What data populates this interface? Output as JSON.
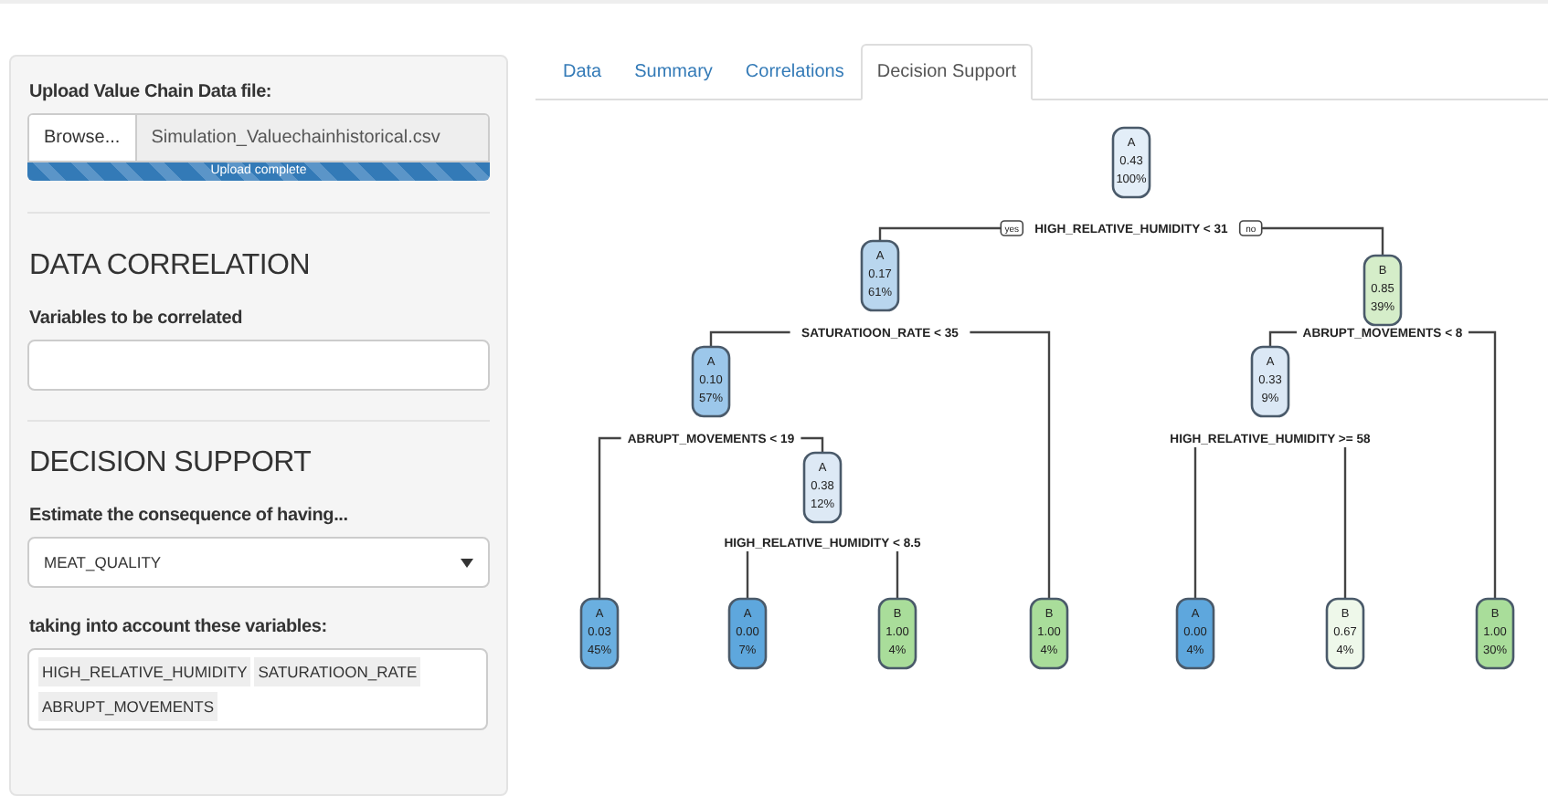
{
  "sidebar": {
    "upload": {
      "label": "Upload Value Chain Data file:",
      "button": "Browse...",
      "file_name": "Simulation_Valuechainhistorical.csv",
      "progress": {
        "level": 1,
        "text": "Upload complete"
      }
    },
    "correlation": {
      "heading": "DATA CORRELATION",
      "label": "Variables to be correlated"
    },
    "decision": {
      "heading": "DECISION SUPPORT",
      "target_label": "Estimate the consequence of having...",
      "target_value": "MEAT_QUALITY",
      "variables_label": "taking into account these variables:",
      "variables": [
        "HIGH_RELATIVE_HUMIDITY",
        "SATURATIOON_RATE",
        "ABRUPT_MOVEMENTS"
      ]
    }
  },
  "tabs": [
    {
      "label": "Data",
      "selected": false
    },
    {
      "label": "Summary",
      "selected": false
    },
    {
      "label": "Correlations",
      "selected": false
    },
    {
      "label": "Decision Support",
      "selected": true
    }
  ],
  "tree": {
    "cls": "A",
    "value": "0.43",
    "pct": "100%",
    "color": "#e3eef8",
    "split": "HIGH_RELATIVE_HUMIDITY < 31",
    "branch_labels": [
      "yes",
      "no"
    ],
    "children": [
      {
        "cls": "A",
        "value": "0.17",
        "pct": "61%",
        "color": "#b9d6ee",
        "split": "SATURATIOON_RATE < 35",
        "children": [
          {
            "cls": "A",
            "value": "0.10",
            "pct": "57%",
            "color": "#9cc7ea",
            "split": "ABRUPT_MOVEMENTS < 19",
            "children": [
              {
                "cls": "A",
                "value": "0.03",
                "pct": "45%",
                "color": "#6aafe0"
              },
              {
                "cls": "A",
                "value": "0.38",
                "pct": "12%",
                "color": "#dde9f5",
                "split": "HIGH_RELATIVE_HUMIDITY < 8.5",
                "children": [
                  {
                    "cls": "A",
                    "value": "0.00",
                    "pct": "7%",
                    "color": "#5ea7dd"
                  },
                  {
                    "cls": "B",
                    "value": "1.00",
                    "pct": "4%",
                    "color": "#a9dd9a"
                  }
                ]
              }
            ]
          },
          {
            "cls": "B",
            "value": "1.00",
            "pct": "4%",
            "color": "#a9dd9a"
          }
        ]
      },
      {
        "cls": "B",
        "value": "0.85",
        "pct": "39%",
        "color": "#d5edc9",
        "split": "ABRUPT_MOVEMENTS < 8",
        "children": [
          {
            "cls": "A",
            "value": "0.33",
            "pct": "9%",
            "color": "#dbe8f5",
            "split": "HIGH_RELATIVE_HUMIDITY >= 58",
            "children": [
              {
                "cls": "A",
                "value": "0.00",
                "pct": "4%",
                "color": "#5ea7dd"
              },
              {
                "cls": "B",
                "value": "0.67",
                "pct": "4%",
                "color": "#eef8ea"
              }
            ]
          },
          {
            "cls": "B",
            "value": "1.00",
            "pct": "30%",
            "color": "#a9dd9a"
          }
        ]
      }
    ]
  }
}
